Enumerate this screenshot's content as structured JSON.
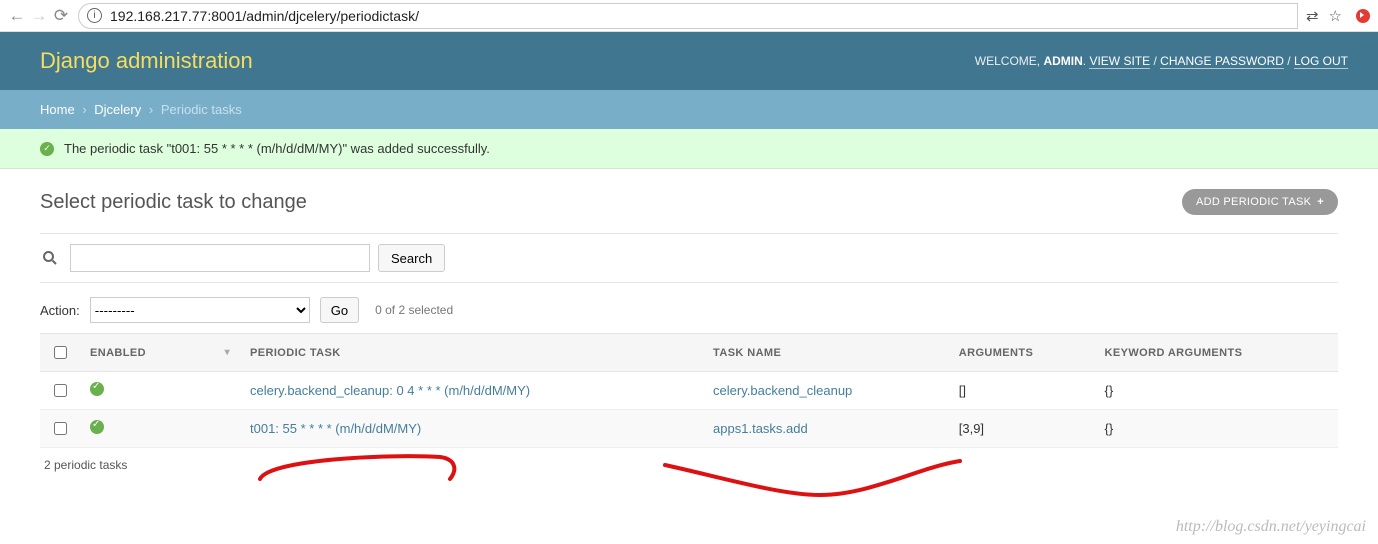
{
  "browser": {
    "url_host": "192.168.217.77",
    "url_port_path": ":8001/admin/djcelery/periodictask/"
  },
  "header": {
    "title": "Django administration",
    "welcome": "WELCOME,",
    "user": "ADMIN",
    "view_site": "VIEW SITE",
    "change_password": "CHANGE PASSWORD",
    "log_out": "LOG OUT"
  },
  "breadcrumbs": {
    "home": "Home",
    "app": "Djcelery",
    "page": "Periodic tasks"
  },
  "message": "The periodic task \"t001: 55 * * * * (m/h/d/dM/MY)\" was added successfully.",
  "page_title": "Select periodic task to change",
  "add_button": "ADD PERIODIC TASK",
  "search": {
    "button": "Search",
    "value": ""
  },
  "actions": {
    "label": "Action:",
    "placeholder": "---------",
    "go": "Go",
    "selected": "0 of 2 selected"
  },
  "columns": {
    "enabled": "ENABLED",
    "periodic_task": "PERIODIC TASK",
    "task_name": "TASK NAME",
    "arguments": "ARGUMENTS",
    "kw_arguments": "KEYWORD ARGUMENTS"
  },
  "rows": [
    {
      "enabled": true,
      "periodic_task": "celery.backend_cleanup: 0 4 * * * (m/h/d/dM/MY)",
      "task_name": "celery.backend_cleanup",
      "arguments": "[]",
      "kw_arguments": "{}"
    },
    {
      "enabled": true,
      "periodic_task": "t001: 55 * * * * (m/h/d/dM/MY)",
      "task_name": "apps1.tasks.add",
      "arguments": "[3,9]",
      "kw_arguments": "{}"
    }
  ],
  "footer": "2 periodic tasks",
  "watermark": "http://blog.csdn.net/yeyingcai"
}
